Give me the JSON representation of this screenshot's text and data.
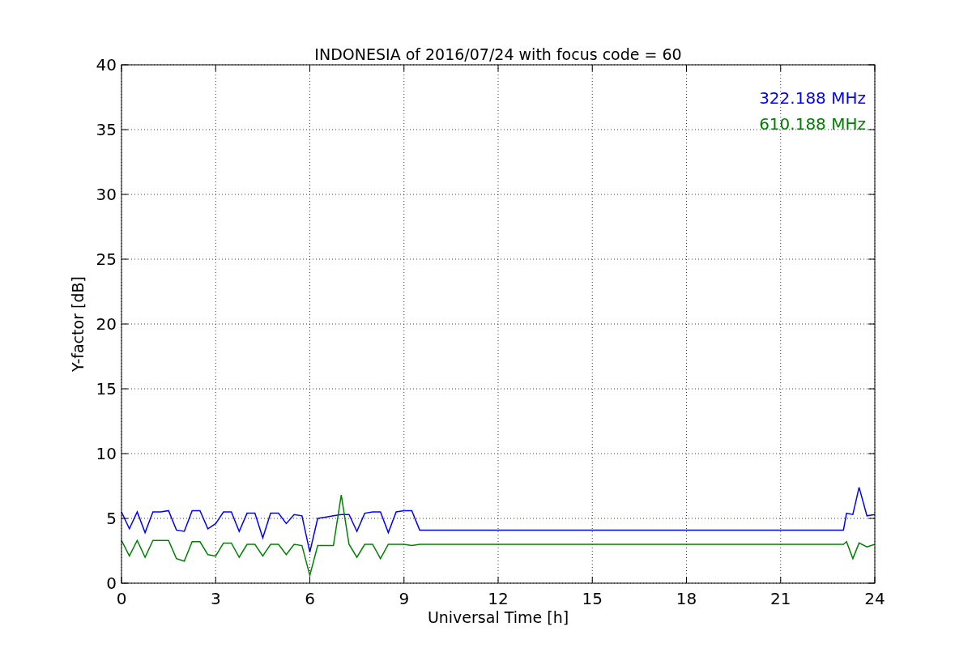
{
  "chart_data": {
    "type": "line",
    "title": "INDONESIA of 2016/07/24 with focus code = 60",
    "xlabel": "Universal Time [h]",
    "ylabel": "Y-factor [dB]",
    "x": [
      0,
      0.25,
      0.5,
      0.75,
      1,
      1.25,
      1.5,
      1.75,
      2,
      2.25,
      2.5,
      2.75,
      3,
      3.25,
      3.5,
      3.75,
      4,
      4.25,
      4.5,
      4.75,
      5,
      5.25,
      5.5,
      5.75,
      6,
      6.25,
      6.5,
      6.75,
      7,
      7.25,
      7.5,
      7.75,
      8,
      8.25,
      8.5,
      8.75,
      9,
      9.25,
      9.5,
      23,
      23.1,
      23.3,
      23.5,
      23.75,
      24
    ],
    "series": [
      {
        "name": "322.188 MHz",
        "color": "#0000ff",
        "values": [
          5.5,
          4.2,
          5.5,
          3.9,
          5.5,
          5.5,
          5.6,
          4.1,
          4.0,
          5.6,
          5.6,
          4.2,
          4.6,
          5.5,
          5.5,
          4.0,
          5.4,
          5.4,
          3.5,
          5.4,
          5.4,
          4.6,
          5.3,
          5.2,
          2.4,
          5.0,
          5.1,
          5.2,
          5.3,
          5.3,
          4.0,
          5.4,
          5.5,
          5.5,
          3.9,
          5.5,
          5.6,
          5.6,
          4.1,
          4.1,
          5.4,
          5.3,
          7.4,
          5.2,
          5.3
        ]
      },
      {
        "name": "610.188 MHz",
        "color": "#008000",
        "values": [
          3.3,
          2.1,
          3.3,
          2.0,
          3.3,
          3.3,
          3.3,
          1.9,
          1.7,
          3.2,
          3.2,
          2.2,
          2.1,
          3.1,
          3.1,
          2.0,
          3.0,
          3.0,
          2.1,
          3.0,
          3.0,
          2.2,
          3.0,
          2.9,
          0.6,
          2.9,
          2.9,
          2.9,
          6.8,
          3.0,
          2.0,
          3.0,
          3.0,
          1.9,
          3.0,
          3.0,
          3.0,
          2.9,
          3.0,
          3.0,
          3.2,
          1.9,
          3.1,
          2.8,
          3.0
        ]
      }
    ],
    "grid": true,
    "xlim": [
      0,
      24
    ],
    "ylim": [
      0,
      40
    ],
    "xticks": [
      0,
      3,
      6,
      9,
      12,
      15,
      18,
      21,
      24
    ],
    "yticks": [
      0,
      5,
      10,
      15,
      20,
      25,
      30,
      35,
      40
    ]
  }
}
